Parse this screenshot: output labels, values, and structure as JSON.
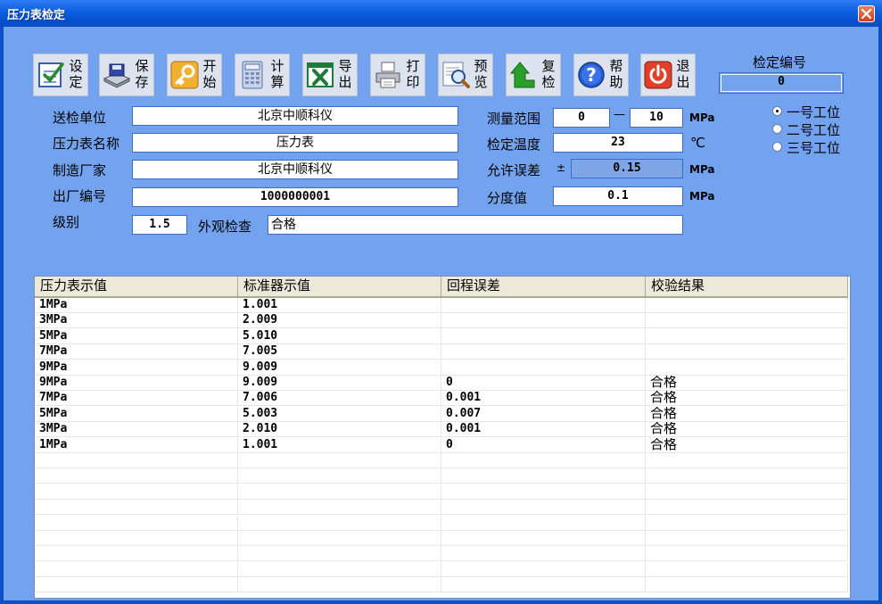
{
  "window": {
    "title": "压力表检定"
  },
  "toolbar": [
    {
      "name": "settings",
      "l1": "设",
      "l2": "定",
      "icon": "checklist-icon"
    },
    {
      "name": "save",
      "l1": "保",
      "l2": "存",
      "icon": "save-device-icon"
    },
    {
      "name": "start",
      "l1": "开",
      "l2": "始",
      "icon": "key-icon"
    },
    {
      "name": "calculate",
      "l1": "计",
      "l2": "算",
      "icon": "calculator-icon"
    },
    {
      "name": "export",
      "l1": "导",
      "l2": "出",
      "icon": "excel-icon"
    },
    {
      "name": "print",
      "l1": "打",
      "l2": "印",
      "icon": "printer-icon"
    },
    {
      "name": "preview",
      "l1": "预",
      "l2": "览",
      "icon": "magnifier-icon"
    },
    {
      "name": "recheck",
      "l1": "复",
      "l2": "检",
      "icon": "green-arrow-icon"
    },
    {
      "name": "help",
      "l1": "帮",
      "l2": "助",
      "icon": "help-icon"
    },
    {
      "name": "exit",
      "l1": "退",
      "l2": "出",
      "icon": "power-icon"
    }
  ],
  "verification_no": {
    "label": "检定编号",
    "value": "0"
  },
  "form": {
    "sender_unit": {
      "label": "送检单位",
      "value": "北京中顺科仪"
    },
    "gauge_name": {
      "label": "压力表名称",
      "value": "压力表"
    },
    "manufacturer": {
      "label": "制造厂家",
      "value": "北京中顺科仪"
    },
    "serial_no": {
      "label": "出厂编号",
      "value": "1000000001"
    },
    "grade": {
      "label": "级别",
      "value": "1.5"
    },
    "appearance": {
      "label": "外观检查",
      "value": "合格"
    },
    "range": {
      "label": "测量范围",
      "min": "0",
      "dash": "—",
      "max": "10",
      "unit": "MPa"
    },
    "temperature": {
      "label": "检定温度",
      "value": "23",
      "unit": "℃"
    },
    "allowed_error": {
      "label": "允许误差",
      "pm": "±",
      "value": "0.15",
      "unit": "MPa"
    },
    "division": {
      "label": "分度值",
      "value": "0.1",
      "unit": "MPa"
    }
  },
  "stations": [
    {
      "label": "一号工位",
      "selected": true
    },
    {
      "label": "二号工位",
      "selected": false
    },
    {
      "label": "三号工位",
      "selected": false
    }
  ],
  "table": {
    "columns": [
      "压力表示值",
      "标准器示值",
      "回程误差",
      "校验结果"
    ],
    "rows": [
      [
        "1MPa",
        "1.001",
        "",
        ""
      ],
      [
        "3MPa",
        "2.009",
        "",
        ""
      ],
      [
        "5MPa",
        "5.010",
        "",
        ""
      ],
      [
        "7MPa",
        "7.005",
        "",
        ""
      ],
      [
        "9MPa",
        "9.009",
        "",
        ""
      ],
      [
        "9MPa",
        "9.009",
        "0",
        "合格"
      ],
      [
        "7MPa",
        "7.006",
        "0.001",
        "合格"
      ],
      [
        "5MPa",
        "5.003",
        "0.007",
        "合格"
      ],
      [
        "3MPa",
        "2.010",
        "0.001",
        "合格"
      ],
      [
        "1MPa",
        "1.001",
        "0",
        "合格"
      ]
    ],
    "empty_rows": 9
  }
}
